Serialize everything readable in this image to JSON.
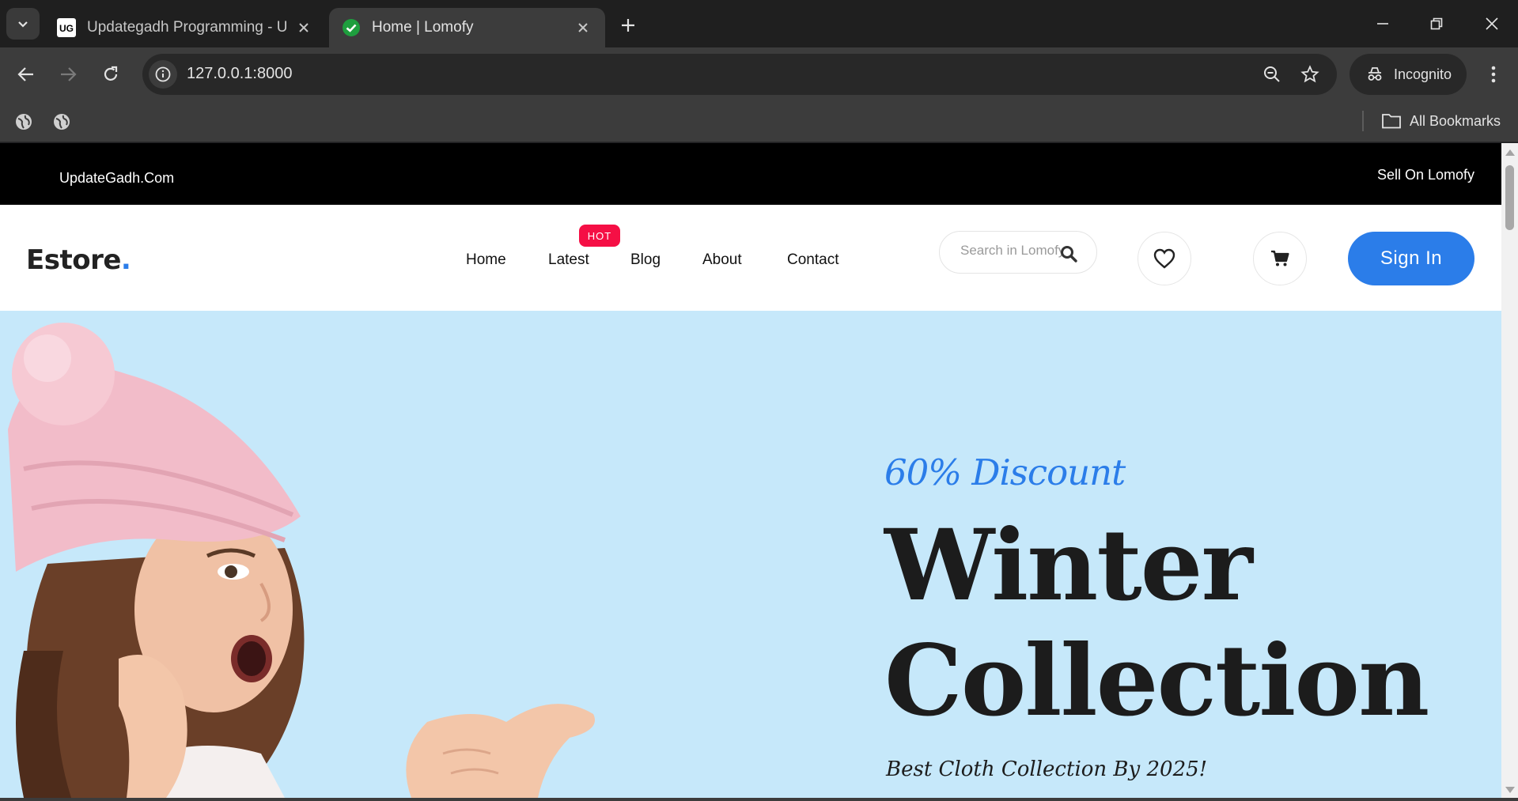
{
  "browser": {
    "tabs": [
      {
        "title": "Updategadh Programming - Up",
        "favicon": "updategadh-favicon-icon",
        "active": false
      },
      {
        "title": "Home | Lomofy",
        "favicon": "check-circle-icon",
        "active": true
      }
    ],
    "url": "127.0.0.1:8000",
    "profile_label": "Incognito",
    "bookmarks_label": "All Bookmarks",
    "colors": {
      "frame": "#1f1f1f",
      "toolbar": "#3c3c3c",
      "omnibox": "#282828"
    }
  },
  "topbar": {
    "brand": "UpdateGadh.Com",
    "sell_link": "Sell On Lomofy"
  },
  "header": {
    "logo_text": "Estore",
    "logo_dot": ".",
    "nav": [
      {
        "label": "Home"
      },
      {
        "label": "Latest"
      },
      {
        "label": "Blog"
      },
      {
        "label": "About"
      },
      {
        "label": "Contact"
      }
    ],
    "hot_badge": "HOT",
    "search_placeholder": "Search in Lomofy",
    "signin_label": "Sign In",
    "colors": {
      "accent": "#2b7de9",
      "badge": "#f50f45"
    }
  },
  "hero": {
    "discount": "60% Discount",
    "title_line1": "Winter",
    "title_line2": "Collection",
    "subtitle": "Best Cloth Collection By 2025!",
    "background": "#c6e8fa"
  }
}
